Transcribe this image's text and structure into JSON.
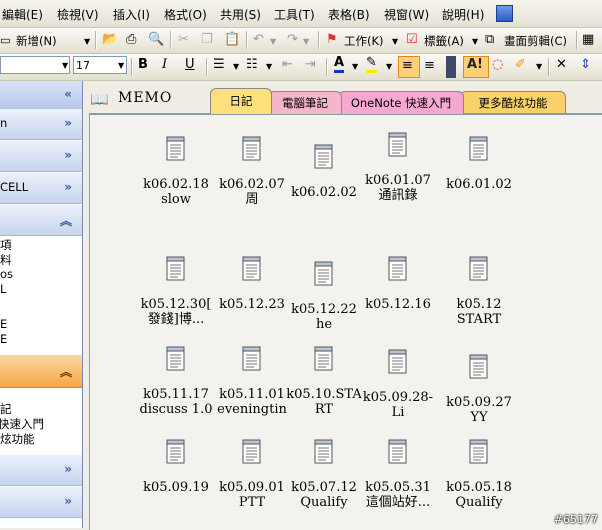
{
  "menubar": {
    "items": [
      "編輯(E)",
      "檢視(V)",
      "插入(I)",
      "格式(O)",
      "共用(S)",
      "工具(T)",
      "表格(B)",
      "視窗(W)",
      "說明(H)"
    ]
  },
  "toolbar1": {
    "new_label": "新增(N)",
    "work_label": "工作(K)",
    "tag_label": "標籤(A)",
    "clip_label": "畫面剪輯(C)"
  },
  "toolbar2": {
    "font_size": "17"
  },
  "sidebar": {
    "partial_lines": [
      "n",
      "CELL",
      "項",
      "料",
      "os",
      "L",
      "E",
      "E",
      "記",
      "快速入門",
      "炫功能"
    ]
  },
  "notebook": {
    "title": "MEMO",
    "tabs": [
      {
        "label": "日記",
        "color": "#ffe07a"
      },
      {
        "label": "電腦筆記",
        "color": "#f4b6c8"
      },
      {
        "label": "OneNote 快速入門",
        "color": "#f6a8d0"
      },
      {
        "label": "更多酷炫功能",
        "color": "#f8d16a"
      }
    ]
  },
  "pages": [
    {
      "line1": "k06.02.18",
      "line2": "slow"
    },
    {
      "line1": "k06.02.07",
      "line2": "周"
    },
    {
      "line1": "k06.02.02",
      "line2": ""
    },
    {
      "line1": "k06.01.07",
      "line2": "通訊錄"
    },
    {
      "line1": "k06.01.02",
      "line2": ""
    },
    {
      "line1": "k05.12.30[",
      "line2": "發錢]博..."
    },
    {
      "line1": "k05.12.23",
      "line2": ""
    },
    {
      "line1": "k05.12.22",
      "line2": "he"
    },
    {
      "line1": "k05.12.16",
      "line2": ""
    },
    {
      "line1": "k05.12",
      "line2": "START"
    },
    {
      "line1": "k05.11.17",
      "line2": "discuss 1.0"
    },
    {
      "line1": "k05.11.01",
      "line2": "eveningtin"
    },
    {
      "line1": "k05.10.STA",
      "line2": "RT"
    },
    {
      "line1": "k05.09.28-",
      "line2": "Li"
    },
    {
      "line1": "k05.09.27",
      "line2": "YY"
    },
    {
      "line1": "k05.09.19",
      "line2": ""
    },
    {
      "line1": "k05.09.01",
      "line2": "PTT"
    },
    {
      "line1": "k05.07.12",
      "line2": "Qualify"
    },
    {
      "line1": "k05.05.31",
      "line2": "這個站好..."
    },
    {
      "line1": "k05.05.18",
      "line2": "Qualify"
    }
  ],
  "watermark": "#65177",
  "colors": {
    "accent": "#f7a642",
    "sidebar_bar": "#c7d4ec"
  }
}
